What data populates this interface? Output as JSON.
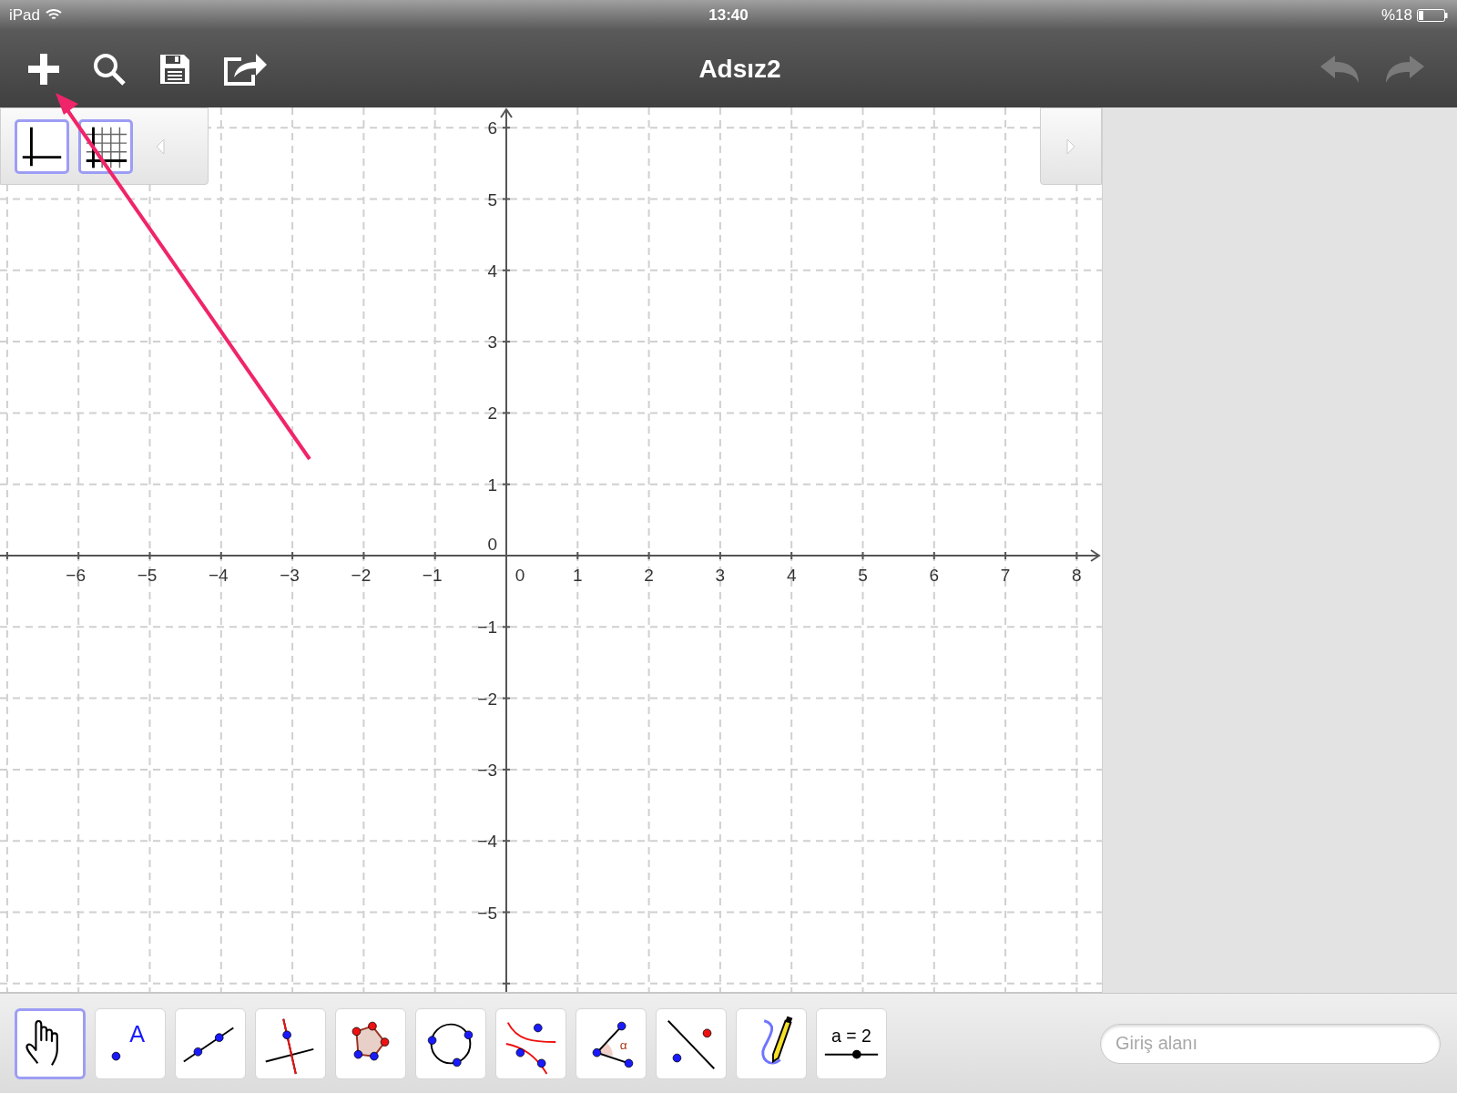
{
  "status_bar": {
    "device": "iPad",
    "time": "13:40",
    "battery": "%18"
  },
  "header": {
    "title": "Adsız2",
    "undo": {
      "disabled": true
    },
    "redo": {
      "disabled": true
    }
  },
  "style_bar": [
    {
      "kind": "axes",
      "on": true
    },
    {
      "kind": "grid",
      "on": true
    }
  ],
  "graphics": {
    "x_labels": [
      "−6",
      "−5",
      "−4",
      "−3",
      "−2",
      "−1",
      "0",
      "1",
      "2",
      "3",
      "4",
      "5",
      "6",
      "7",
      "8"
    ],
    "y_labels": [
      "6",
      "5",
      "4",
      "3",
      "2",
      "1",
      "0",
      "−1",
      "−2",
      "−3",
      "−4",
      "−5"
    ]
  },
  "tools": [
    {
      "kind": "move",
      "selected": true
    },
    {
      "kind": "point",
      "selected": false,
      "label": "A"
    },
    {
      "kind": "line",
      "selected": false
    },
    {
      "kind": "perpendicular",
      "selected": false
    },
    {
      "kind": "polygon",
      "selected": false
    },
    {
      "kind": "circle",
      "selected": false
    },
    {
      "kind": "conic",
      "selected": false
    },
    {
      "kind": "angle",
      "selected": false,
      "label": "α"
    },
    {
      "kind": "reflect",
      "selected": false
    },
    {
      "kind": "pen",
      "selected": false
    },
    {
      "kind": "slider",
      "selected": false,
      "label": "a = 2"
    }
  ],
  "input_bar": {
    "placeholder": "Giriş alanı"
  }
}
